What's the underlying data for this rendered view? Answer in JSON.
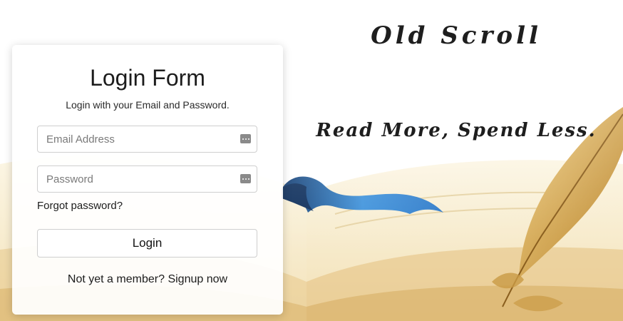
{
  "brand": {
    "name": "Old Scroll",
    "tagline": "Read More, Spend Less."
  },
  "login_form": {
    "title": "Login Form",
    "subtitle": "Login with your Email and Password.",
    "email": {
      "placeholder": "Email Address",
      "value": ""
    },
    "password": {
      "placeholder": "Password",
      "value": ""
    },
    "forgot_label": "Forgot password?",
    "submit_label": "Login",
    "signup_prompt": "Not yet a member?",
    "signup_link": "Signup now"
  },
  "icons": {
    "field_icon": "password-manager-key-icon",
    "background": "open-book-with-quill-and-ribbon"
  },
  "colors": {
    "text": "#1c1c1c",
    "card_bg": "#ffffff",
    "border": "#cfcfcf",
    "ribbon": "#2f7fd0",
    "quill": "#c99a45",
    "page": "#f3e3b8"
  }
}
